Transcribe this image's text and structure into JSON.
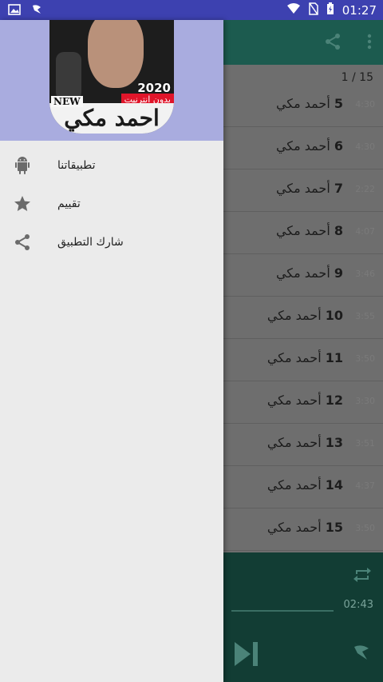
{
  "status_bar": {
    "time": "01:27"
  },
  "toolbar": {
    "page_indicator": "1 / 15"
  },
  "songs": [
    {
      "num": "5",
      "artist": "أحمد مكي",
      "duration": "4:30"
    },
    {
      "num": "6",
      "artist": "أحمد مكي",
      "duration": "4:30"
    },
    {
      "num": "7",
      "artist": "أحمد مكي",
      "duration": "2:22"
    },
    {
      "num": "8",
      "artist": "أحمد مكي",
      "duration": "4:07"
    },
    {
      "num": "9",
      "artist": "أحمد مكي",
      "duration": "3:46"
    },
    {
      "num": "10",
      "artist": "أحمد مكي",
      "duration": "3:55"
    },
    {
      "num": "11",
      "artist": "أحمد مكي",
      "duration": "3:50"
    },
    {
      "num": "12",
      "artist": "أحمد مكي",
      "duration": "3:30"
    },
    {
      "num": "13",
      "artist": "أحمد مكي",
      "duration": "3:51"
    },
    {
      "num": "14",
      "artist": "أحمد مكي",
      "duration": "4:37"
    },
    {
      "num": "15",
      "artist": "أحمد مكي",
      "duration": "3:50"
    }
  ],
  "player": {
    "total_time": "02:43"
  },
  "drawer": {
    "cover": {
      "title": "احمد مكي",
      "new_label": "NEW",
      "year": "2020",
      "badge": "بدون انترنيت"
    },
    "menu": [
      {
        "label": "تطبيقاتنا",
        "icon": "android-icon"
      },
      {
        "label": "تقييم",
        "icon": "star-icon"
      },
      {
        "label": "شارك التطبيق",
        "icon": "share-icon"
      }
    ]
  }
}
